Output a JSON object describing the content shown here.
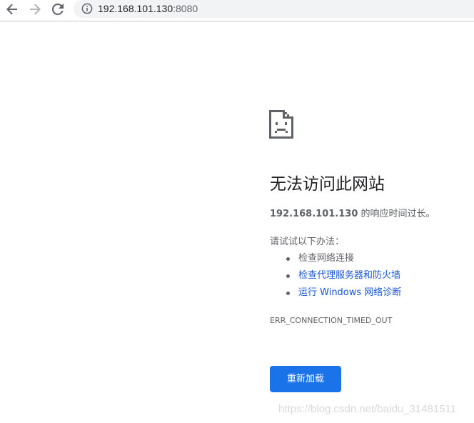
{
  "browser": {
    "url_host": "192.168.101.130",
    "url_port": ":8080",
    "icons": {
      "back": "back-arrow-icon",
      "forward": "forward-arrow-icon",
      "reload": "reload-icon",
      "info": "info-icon"
    }
  },
  "error_page": {
    "icon": "sad-document-icon",
    "title": "无法访问此网站",
    "message_host": "192.168.101.130",
    "message_suffix": " 的响应时间过长。",
    "try_label": "请试试以下办法：",
    "suggestions": [
      {
        "label": "检查网络连接",
        "is_link": false
      },
      {
        "label": "检查代理服务器和防火墙",
        "is_link": true
      },
      {
        "label": "运行 Windows 网络诊断",
        "is_link": true
      }
    ],
    "error_code": "ERR_CONNECTION_TIMED_OUT",
    "reload_label": "重新加载"
  },
  "watermark": "https://blog.csdn.net/baidu_31481511",
  "colors": {
    "button_bg": "#1a73e8",
    "link": "#1a56d6",
    "text_secondary": "#5f6368",
    "omnibox_bg": "#f1f3f4"
  }
}
